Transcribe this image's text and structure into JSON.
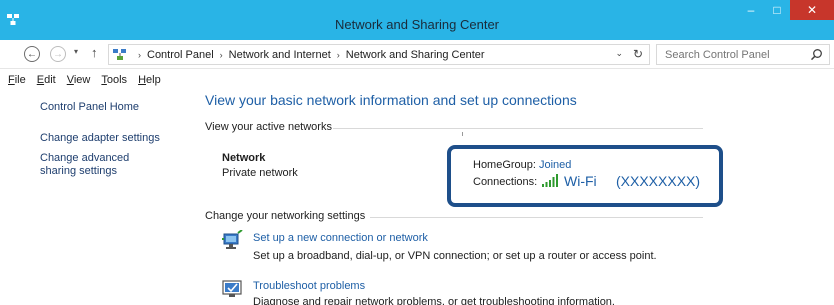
{
  "window": {
    "title": "Network and Sharing Center",
    "minimize_glyph": "–",
    "maximize_glyph": "□",
    "close_glyph": "✕"
  },
  "address": {
    "back_glyph": "←",
    "forward_glyph": "→",
    "recent_glyph": "▾",
    "up_glyph": "↑",
    "breadcrumbs": [
      "Control Panel",
      "Network and Internet",
      "Network and Sharing Center"
    ],
    "separator": "›",
    "dropdown_glyph": "⌄",
    "refresh_glyph": "↻"
  },
  "search": {
    "placeholder": "Search Control Panel"
  },
  "menu": {
    "items": [
      {
        "key": "F",
        "rest": "ile"
      },
      {
        "key": "E",
        "rest": "dit"
      },
      {
        "key": "V",
        "rest": "iew"
      },
      {
        "key": "T",
        "rest": "ools"
      },
      {
        "key": "H",
        "rest": "elp"
      }
    ]
  },
  "sidebar": {
    "items": [
      {
        "label": "Control Panel Home"
      },
      {
        "label": "Change adapter settings"
      },
      {
        "label": "Change advanced sharing settings"
      }
    ]
  },
  "main": {
    "title": "View your basic network information and set up connections",
    "active_networks_label": "View your active networks",
    "network": {
      "name": "Network",
      "type": "Private network",
      "homegroup_label": "HomeGroup:",
      "homegroup_value": "Joined",
      "connections_label": "Connections:",
      "connection_name": "Wi-Fi",
      "ssid": "(XXXXXXXX)"
    },
    "change_settings_label": "Change your networking settings",
    "tasks": [
      {
        "icon": "new-connection-icon",
        "link": "Set up a new connection or network",
        "description": "Set up a broadband, dial-up, or VPN connection; or set up a router or access point."
      },
      {
        "icon": "troubleshoot-icon",
        "link": "Troubleshoot problems",
        "description": "Diagnose and repair network problems, or get troubleshooting information."
      }
    ]
  },
  "colors": {
    "titlebar": "#29b4e6",
    "close_button": "#c7362b",
    "link": "#1e5fa6",
    "highlight_border": "#1e4f8a",
    "wifi_bars": "#2e9a2e"
  }
}
